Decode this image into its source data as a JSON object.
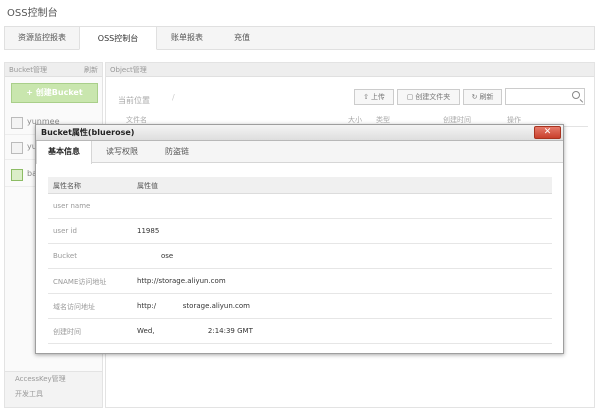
{
  "app": {
    "title": "OSS控制台"
  },
  "tabs": [
    {
      "label": "资源监控报表"
    },
    {
      "label": "OSS控制台"
    },
    {
      "label": "账单报表"
    },
    {
      "label": "充值"
    }
  ],
  "sidebar": {
    "header": "Bucket管理",
    "refresh": "刷新",
    "create_button": "+ 创建Bucket",
    "buckets": [
      {
        "name": "yunmee"
      },
      {
        "name": "yu"
      },
      {
        "name": "ba"
      }
    ],
    "footer": [
      {
        "label": "AccessKey管理"
      },
      {
        "label": "开发工具"
      }
    ]
  },
  "main": {
    "header": "Object管理",
    "current_path_label": "当前位置",
    "path_sep": "/",
    "toolbar": {
      "upload": "上传",
      "create_folder": "创建文件夹",
      "refresh": "刷新",
      "search_placeholder": ""
    },
    "columns": [
      "文件名",
      "大小",
      "类型",
      "创建时间",
      "操作"
    ]
  },
  "dialog": {
    "title": "Bucket属性(bluerose)",
    "close_label": "✕",
    "tabs": [
      {
        "label": "基本信息"
      },
      {
        "label": "读写权限"
      },
      {
        "label": "防盗链"
      }
    ],
    "table_headers": {
      "name": "属性名称",
      "value": "属性值"
    },
    "rows": [
      {
        "key": "user name",
        "value": ""
      },
      {
        "key": "user id",
        "value": "11985"
      },
      {
        "key": "Bucket",
        "value": "ose"
      },
      {
        "key": "CNAME访问地址",
        "value": "http://storage.aliyun.com"
      },
      {
        "key": "域名访问地址",
        "value": "http:/            storage.aliyun.com"
      },
      {
        "key": "创建时间",
        "value": "Wed,                        2:14:39 GMT"
      }
    ]
  }
}
